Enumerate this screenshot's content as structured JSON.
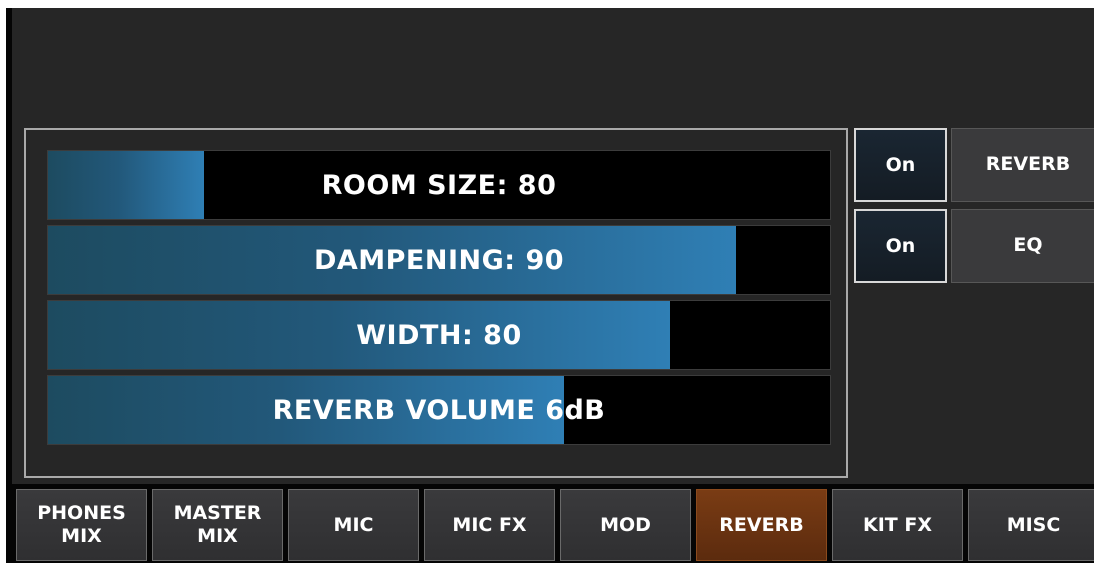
{
  "sliders": [
    {
      "label": "ROOM SIZE: 80",
      "level_percent": 20
    },
    {
      "label": "DAMPENING: 90",
      "level_percent": 88
    },
    {
      "label": "WIDTH: 80",
      "level_percent": 79.5
    },
    {
      "label": "REVERB VOLUME 6dB",
      "level_percent": 66
    }
  ],
  "side_controls": [
    {
      "state": "On",
      "name": "REVERB"
    },
    {
      "state": "On",
      "name": "EQ"
    }
  ],
  "tabs": [
    {
      "label": "PHONES\nMIX",
      "active": false
    },
    {
      "label": "MASTER\nMIX",
      "active": false
    },
    {
      "label": "MIC",
      "active": false
    },
    {
      "label": "MIC FX",
      "active": false
    },
    {
      "label": "MOD",
      "active": false
    },
    {
      "label": "REVERB",
      "active": true
    },
    {
      "label": "KIT FX",
      "active": false
    },
    {
      "label": "MISC",
      "active": false
    }
  ],
  "colors": {
    "accent_active_tab": "#7a3c14",
    "slider_fill": "#2f7fb5",
    "background": "#262626"
  }
}
